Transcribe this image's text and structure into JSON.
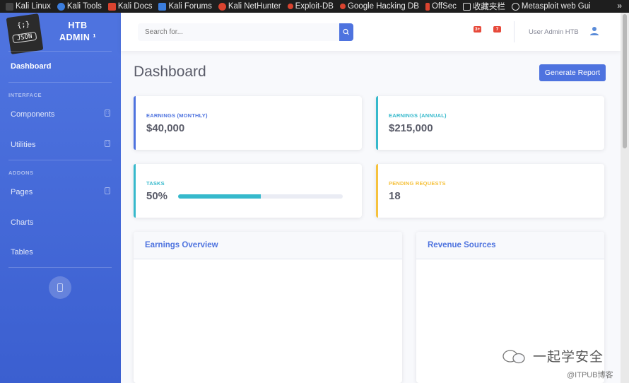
{
  "bookmarks": [
    {
      "label": "Kali Linux",
      "color": "#1e1e1e"
    },
    {
      "label": "Kali Tools",
      "color": "#3b7ddd"
    },
    {
      "label": "Kali Docs",
      "color": "#d9432f"
    },
    {
      "label": "Kali Forums",
      "color": "#3b7ddd"
    },
    {
      "label": "Kali NetHunter",
      "color": "#d9432f"
    },
    {
      "label": "Exploit-DB",
      "color": "#d9432f"
    },
    {
      "label": "Google Hacking DB",
      "color": "#d9432f"
    },
    {
      "label": "OffSec",
      "color": "#d9432f"
    },
    {
      "label": "收藏夹栏",
      "color": "#1e1e1e"
    },
    {
      "label": "Metasploit web Gui",
      "color": "#1e1e1e"
    }
  ],
  "bookmarks_more": "»",
  "sidebar": {
    "logo_top": "{;}",
    "logo_text": "JSON",
    "brand_line1": "HTB",
    "brand_line2": "ADMIN ¹",
    "items": {
      "dashboard": "Dashboard",
      "components": "Components",
      "utilities": "Utilities",
      "pages": "Pages",
      "charts": "Charts",
      "tables": "Tables"
    },
    "headings": {
      "interface": "INTERFACE",
      "addons": "ADDONS"
    },
    "caret": "∷"
  },
  "topbar": {
    "search_placeholder": "Search for...",
    "alerts_badge": "3+",
    "messages_badge": "7",
    "user_name": "User Admin HTB"
  },
  "main": {
    "title": "Dashboard",
    "report_button": "Generate Report",
    "cards": {
      "earnings_monthly": {
        "label": "EARNINGS (MONTHLY)",
        "value": "$40,000",
        "color": "#4e73df"
      },
      "earnings_annual": {
        "label": "EARNINGS (ANNUAL)",
        "value": "$215,000",
        "color": "#36b9cc"
      },
      "tasks": {
        "label": "TASKS",
        "value": "50%",
        "progress": 0.5,
        "color": "#36b9cc"
      },
      "pending": {
        "label": "PENDING REQUESTS",
        "value": "18",
        "color": "#f6c23e"
      }
    },
    "earnings_overview": "Earnings Overview",
    "revenue_sources": "Revenue Sources"
  },
  "watermark": {
    "text": "一起学安全",
    "sub": "@ITPUB博客"
  }
}
